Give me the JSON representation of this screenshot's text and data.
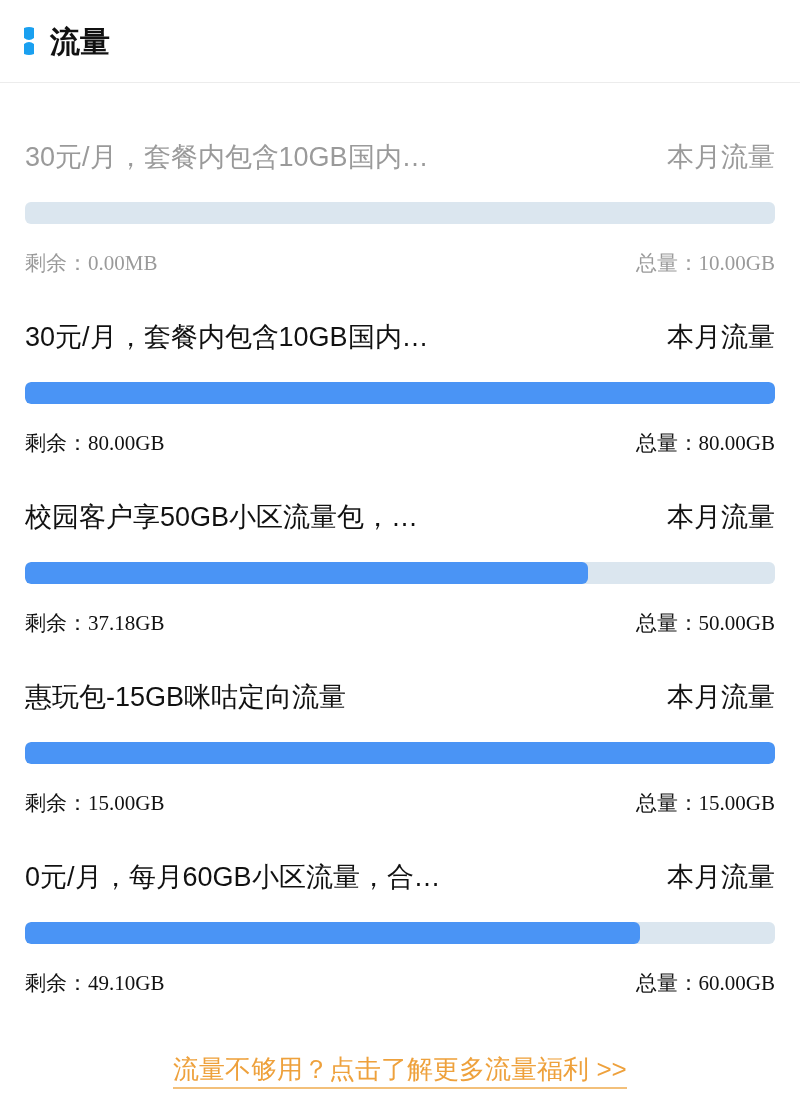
{
  "header": {
    "title": "流量"
  },
  "packages": [
    {
      "name": "30元/月，套餐内包含10GB国内…",
      "period": "本月流量",
      "level": 0,
      "remaining": "剩余：0.00MB",
      "total": "总量：10.00GB",
      "disabled": true
    },
    {
      "name": "30元/月，套餐内包含10GB国内…",
      "period": "本月流量",
      "level": 1,
      "remaining": "剩余：80.00GB",
      "total": "总量：80.00GB",
      "disabled": false
    },
    {
      "name": "校园客户享50GB小区流量包，…",
      "period": "本月流量",
      "level": 0.75,
      "remaining": "剩余：37.18GB",
      "total": "总量：50.00GB",
      "disabled": false
    },
    {
      "name": "惠玩包-15GB咪咕定向流量",
      "period": "本月流量",
      "level": 1,
      "remaining": "剩余：15.00GB",
      "total": "总量：15.00GB",
      "disabled": false
    },
    {
      "name": "0元/月，每月60GB小区流量，合…",
      "period": "本月流量",
      "level": 0.82,
      "remaining": "剩余：49.10GB",
      "total": "总量：60.00GB",
      "disabled": false
    }
  ],
  "promo_link": "流量不够用？点击了解更多流量福利 >>"
}
